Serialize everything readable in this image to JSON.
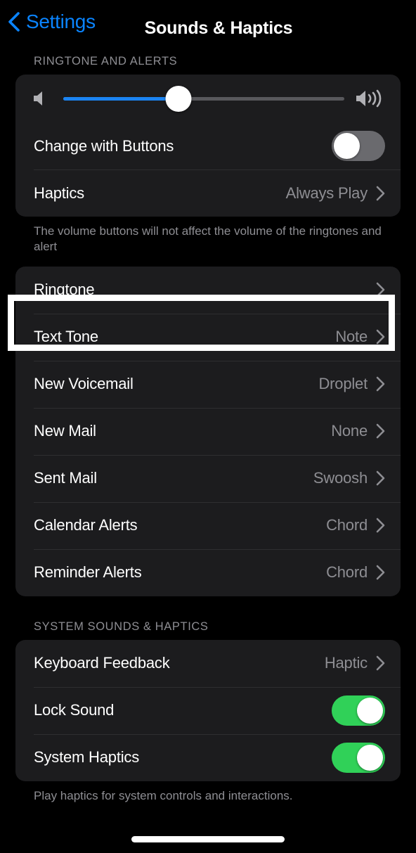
{
  "navbar": {
    "back_label": "Settings",
    "back_icon": "chevron-left-icon",
    "title": "Sounds & Haptics"
  },
  "ringtone_section": {
    "header": "RINGTONE AND ALERTS",
    "volume": {
      "low_icon": "speaker-low-icon",
      "high_icon": "speaker-high-icon",
      "value_percent": 41,
      "fill_color": "#1b84f2",
      "track_color": "#58585c"
    },
    "change_with_buttons": {
      "label": "Change with Buttons",
      "state": "off",
      "off_color": "#6a6a6e"
    },
    "haptics": {
      "label": "Haptics",
      "value": "Always Play",
      "chevron": "chevron-right-icon"
    },
    "footer": "The volume buttons will not affect the volume of the ringtones and alert"
  },
  "tones_section": {
    "highlighted_index": 0,
    "rows": [
      {
        "label": "Ringtone",
        "value": "",
        "chevron": "chevron-right-icon"
      },
      {
        "label": "Text Tone",
        "value": "Note",
        "chevron": "chevron-right-icon"
      },
      {
        "label": "New Voicemail",
        "value": "Droplet",
        "chevron": "chevron-right-icon"
      },
      {
        "label": "New Mail",
        "value": "None",
        "chevron": "chevron-right-icon"
      },
      {
        "label": "Sent Mail",
        "value": "Swoosh",
        "chevron": "chevron-right-icon"
      },
      {
        "label": "Calendar Alerts",
        "value": "Chord",
        "chevron": "chevron-right-icon"
      },
      {
        "label": "Reminder Alerts",
        "value": "Chord",
        "chevron": "chevron-right-icon"
      }
    ]
  },
  "system_section": {
    "header": "SYSTEM SOUNDS & HAPTICS",
    "keyboard_feedback": {
      "label": "Keyboard Feedback",
      "value": "Haptic",
      "chevron": "chevron-right-icon"
    },
    "lock_sound": {
      "label": "Lock Sound",
      "state": "on",
      "on_color": "#30d158"
    },
    "system_haptics": {
      "label": "System Haptics",
      "state": "on",
      "on_color": "#30d158"
    },
    "footer": "Play haptics for system controls and interactions."
  },
  "theme": {
    "background": "#000000",
    "card_background": "#1c1c1e",
    "accent_blue": "#0a84ff",
    "secondary_text": "#8e8e93",
    "highlight_border": "#ffffff"
  }
}
